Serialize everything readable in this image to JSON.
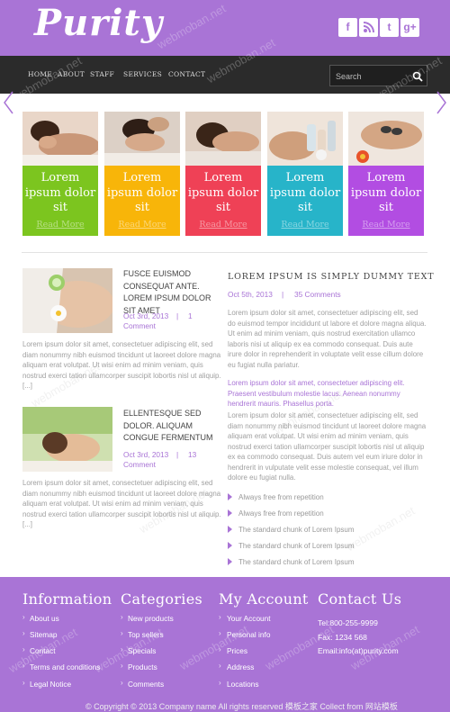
{
  "site": {
    "logo": "Purity"
  },
  "social": [
    {
      "icon": "facebook-icon",
      "glyph": "f"
    },
    {
      "icon": "rss-icon",
      "glyph": "◥"
    },
    {
      "icon": "twitter-icon",
      "glyph": "t"
    },
    {
      "icon": "google-plus-icon",
      "glyph": "g+"
    }
  ],
  "nav": [
    "HOME",
    "ABOUT",
    "STAFF",
    "SERVICES",
    "CONTACT"
  ],
  "search": {
    "placeholder": "Search"
  },
  "tiles": [
    {
      "text": "Lorem ipsum dolor sit",
      "link": "Read More",
      "color": "#7cc51f"
    },
    {
      "text": "Lorem ipsum dolor sit",
      "link": "Read More",
      "color": "#f8b509"
    },
    {
      "text": "Lorem ipsum dolor sit",
      "link": "Read More",
      "color": "#ef4156"
    },
    {
      "text": "Lorem ipsum dolor sit",
      "link": "Read More",
      "color": "#27b4c9"
    },
    {
      "text": "Lorem ipsum dolor sit",
      "link": "Read More",
      "color": "#b24de2"
    }
  ],
  "posts": [
    {
      "title": "FUSCE EUISMOD CONSEQUAT ANTE. LOREM IPSUM DOLOR SIT AMET",
      "date": "Oct 3rd, 2013",
      "sep": "|",
      "comments_count": "1",
      "comments_label": "Comment",
      "excerpt": "Lorem ipsum dolor sit amet, consectetuer adipiscing elit, sed diam nonummy nibh euismod tincidunt ut laoreet dolore magna aliquam erat volutpat. Ut wisi enim ad minim veniam, quis nostrud exerci tation ullamcorper suscipit lobortis nisl ut aliquip. [...]"
    },
    {
      "title": "ELLENTESQUE SED DOLOR. ALIQUAM CONGUE FERMENTUM",
      "date": "Oct 3rd, 2013",
      "sep": "|",
      "comments_count": "13",
      "comments_label": "Comment",
      "excerpt": "Lorem ipsum dolor sit amet, consectetuer adipiscing elit, sed diam nonummy nibh euismod tincidunt ut laoreet dolore magna aliquam erat volutpat. Ut wisi enim ad minim veniam, quis nostrud exerci tation ullamcorper suscipit lobortis nisl ut aliquip. [...]"
    }
  ],
  "feature": {
    "title": "LOREM IPSUM IS SIMPLY DUMMY TEXT",
    "date": "Oct 5th, 2013",
    "sep": "|",
    "comments": "35 Comments",
    "para1": "Lorem ipsum dolor sit amet, consectetuer adipiscing elit, sed do euismod tempor incididunt ut labore et dolore magna aliqua. Ut enim ad minim veniam, quis nostrud exercitation ullamco laboris nisi ut aliquip ex ea commodo consequat. Duis aute irure dolor in reprehenderit in voluptate velit esse cillum dolore eu fugiat nulla pariatur.",
    "para2": "Lorem ipsum dolor sit amet, consectetuer adipiscing elit. Praesent vestibulum molestie lacus. Aenean nonummy hendrerit mauris. Phasellus porta.",
    "para3": "Lorem ipsum dolor sit amet, consectetuer adipiscing elit, sed diam nonummy nibh euismod tincidunt ut laoreet dolore magna aliquam erat volutpat. Ut wisi enim ad minim veniam, quis nostrud exerci tation ullamcorper suscipit lobortis nisl ut aliquip ex ea commodo consequat. Duis autem vel eum iriure dolor in hendrerit in vulputate velit esse molestie consequat, vel illum dolore eu fugiat nulla.",
    "bullets": [
      "Always free from repetition",
      "Always free from repetition",
      "The standard chunk of Lorem Ipsum",
      "The standard chunk of Lorem Ipsum",
      "The standard chunk of Lorem Ipsum"
    ]
  },
  "footer": {
    "columns": [
      {
        "heading": "Information",
        "links": [
          "About us",
          "Sitemap",
          "Contact",
          "Terms and conditions",
          "Legal Notice"
        ]
      },
      {
        "heading": "Categories",
        "links": [
          "New products",
          "Top sellers",
          "Specials",
          "Products",
          "Comments"
        ]
      },
      {
        "heading": "My Account",
        "links": [
          "Your Account",
          "Personal info",
          "Prices",
          "Address",
          "Locations"
        ]
      }
    ],
    "contact": {
      "heading": "Contact Us",
      "tel": "Tel:800-255-9999",
      "fax": "Fax: 1234 568",
      "email": "Email:info(at)purity.com"
    },
    "copyright": "© Copyright © 2013 Company name All rights reserved 模板之家 Collect from 网站模板"
  },
  "watermark": "webmoban.net",
  "colors": {
    "accent": "#a974d6",
    "nav": "#2b2b2b"
  }
}
